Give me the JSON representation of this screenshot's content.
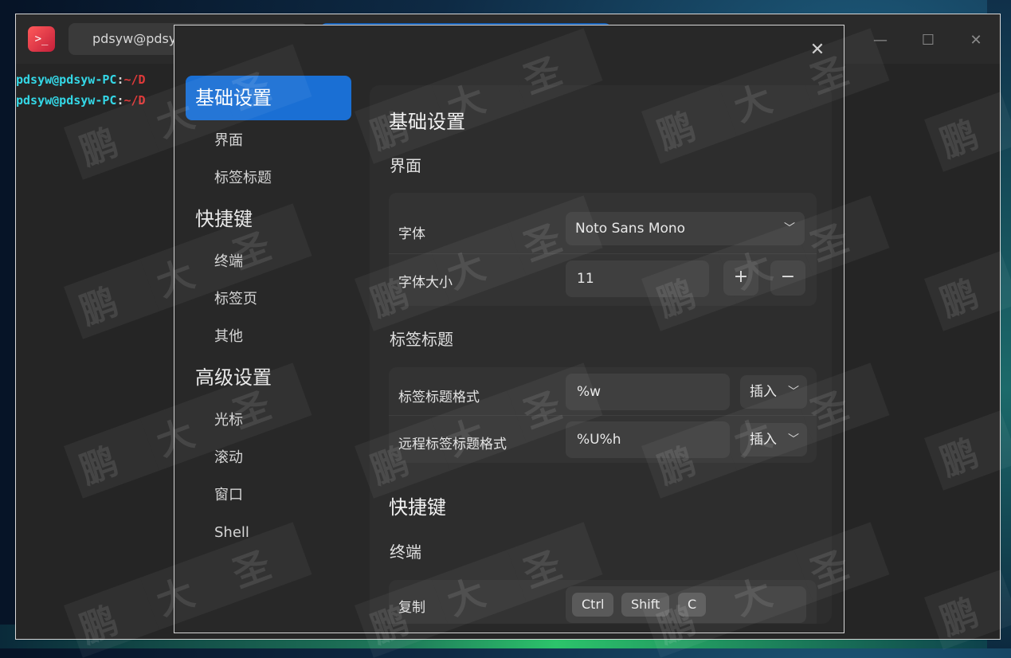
{
  "terminal": {
    "tab_label": "pdsyw@pdsy",
    "lines": [
      {
        "user": "pdsyw@pdsyw-PC",
        "sep": ":",
        "path": "~/D"
      },
      {
        "user": "pdsyw@pdsyw-PC",
        "sep": ":",
        "path": "~/D"
      }
    ],
    "controls": {
      "minimize": "—",
      "maximize": "☐",
      "close": "✕"
    }
  },
  "dialog": {
    "close_icon": "✕",
    "nav": [
      {
        "label": "基础设置",
        "type": "section",
        "active": true
      },
      {
        "label": "界面",
        "type": "item"
      },
      {
        "label": "标签标题",
        "type": "item"
      },
      {
        "label": "快捷键",
        "type": "section"
      },
      {
        "label": "终端",
        "type": "item"
      },
      {
        "label": "标签页",
        "type": "item"
      },
      {
        "label": "其他",
        "type": "item"
      },
      {
        "label": "高级设置",
        "type": "section"
      },
      {
        "label": "光标",
        "type": "item"
      },
      {
        "label": "滚动",
        "type": "item"
      },
      {
        "label": "窗口",
        "type": "item"
      },
      {
        "label": "Shell",
        "type": "item"
      }
    ],
    "content": {
      "basic_title": "基础设置",
      "interface_title": "界面",
      "font_label": "字体",
      "font_value": "Noto Sans Mono",
      "font_size_label": "字体大小",
      "font_size_value": "11",
      "plus": "+",
      "minus": "−",
      "tab_title_title": "标签标题",
      "tab_title_format_label": "标签标题格式",
      "tab_title_format_value": "%w",
      "remote_tab_title_format_label": "远程标签标题格式",
      "remote_tab_title_format_value": "%U%h",
      "insert_label": "插入",
      "shortcuts_title": "快捷键",
      "terminal_title": "终端",
      "copy_label": "复制",
      "copy_keys": [
        "Ctrl",
        "Shift",
        "C"
      ]
    }
  },
  "watermark": {
    "text": [
      "鹏",
      "大",
      "圣"
    ]
  },
  "colors": {
    "accent": "#1a6fd4",
    "terminal_user": "#34d7e6",
    "terminal_path": "#e03a3a"
  }
}
